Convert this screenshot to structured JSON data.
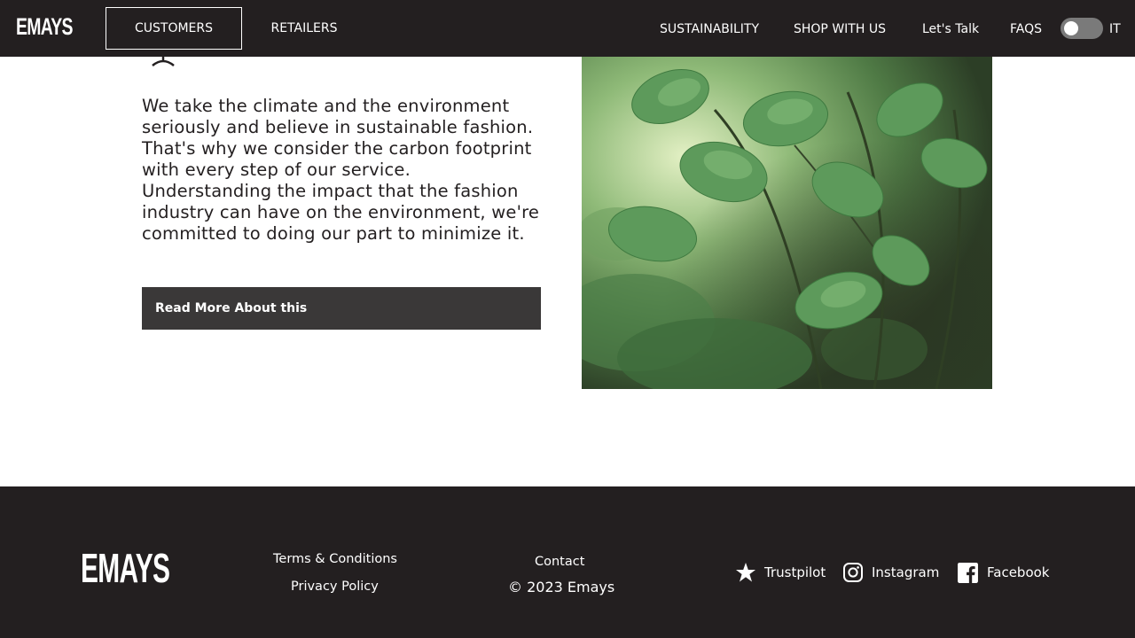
{
  "header": {
    "logo": "EMAYS",
    "tabs": [
      {
        "label": "CUSTOMERS",
        "active": true
      },
      {
        "label": "RETAILERS",
        "active": false
      }
    ],
    "links": [
      "SUSTAINABILITY",
      "SHOP WITH US",
      "Let's Talk",
      "FAQS"
    ],
    "language_toggle": {
      "state": "off"
    },
    "language": "IT"
  },
  "main": {
    "paragraphs": [
      "We take the climate and the environment seriously and believe in sustainable fashion. That's why we consider the carbon footprint with every step of our service.",
      "Understanding the impact that the fashion industry can have on the environment, we're committed to doing our part to minimize it."
    ],
    "button_label": "Read More About this",
    "image_subject": "green leaves"
  },
  "footer": {
    "logo": "EMAYS",
    "links": [
      "Terms & Conditions",
      "Privacy Policy",
      "Contact"
    ],
    "copyright": "© 2023 Emays",
    "socials": [
      {
        "label": "Trustpilot",
        "icon": "star-icon"
      },
      {
        "label": "Instagram",
        "icon": "instagram-icon"
      },
      {
        "label": "Facebook",
        "icon": "facebook-icon"
      }
    ]
  },
  "colors": {
    "dark_background": "#231f20",
    "button_background": "#3a3838",
    "text": "#231f20",
    "toggle_track": "#7a7a7a"
  }
}
